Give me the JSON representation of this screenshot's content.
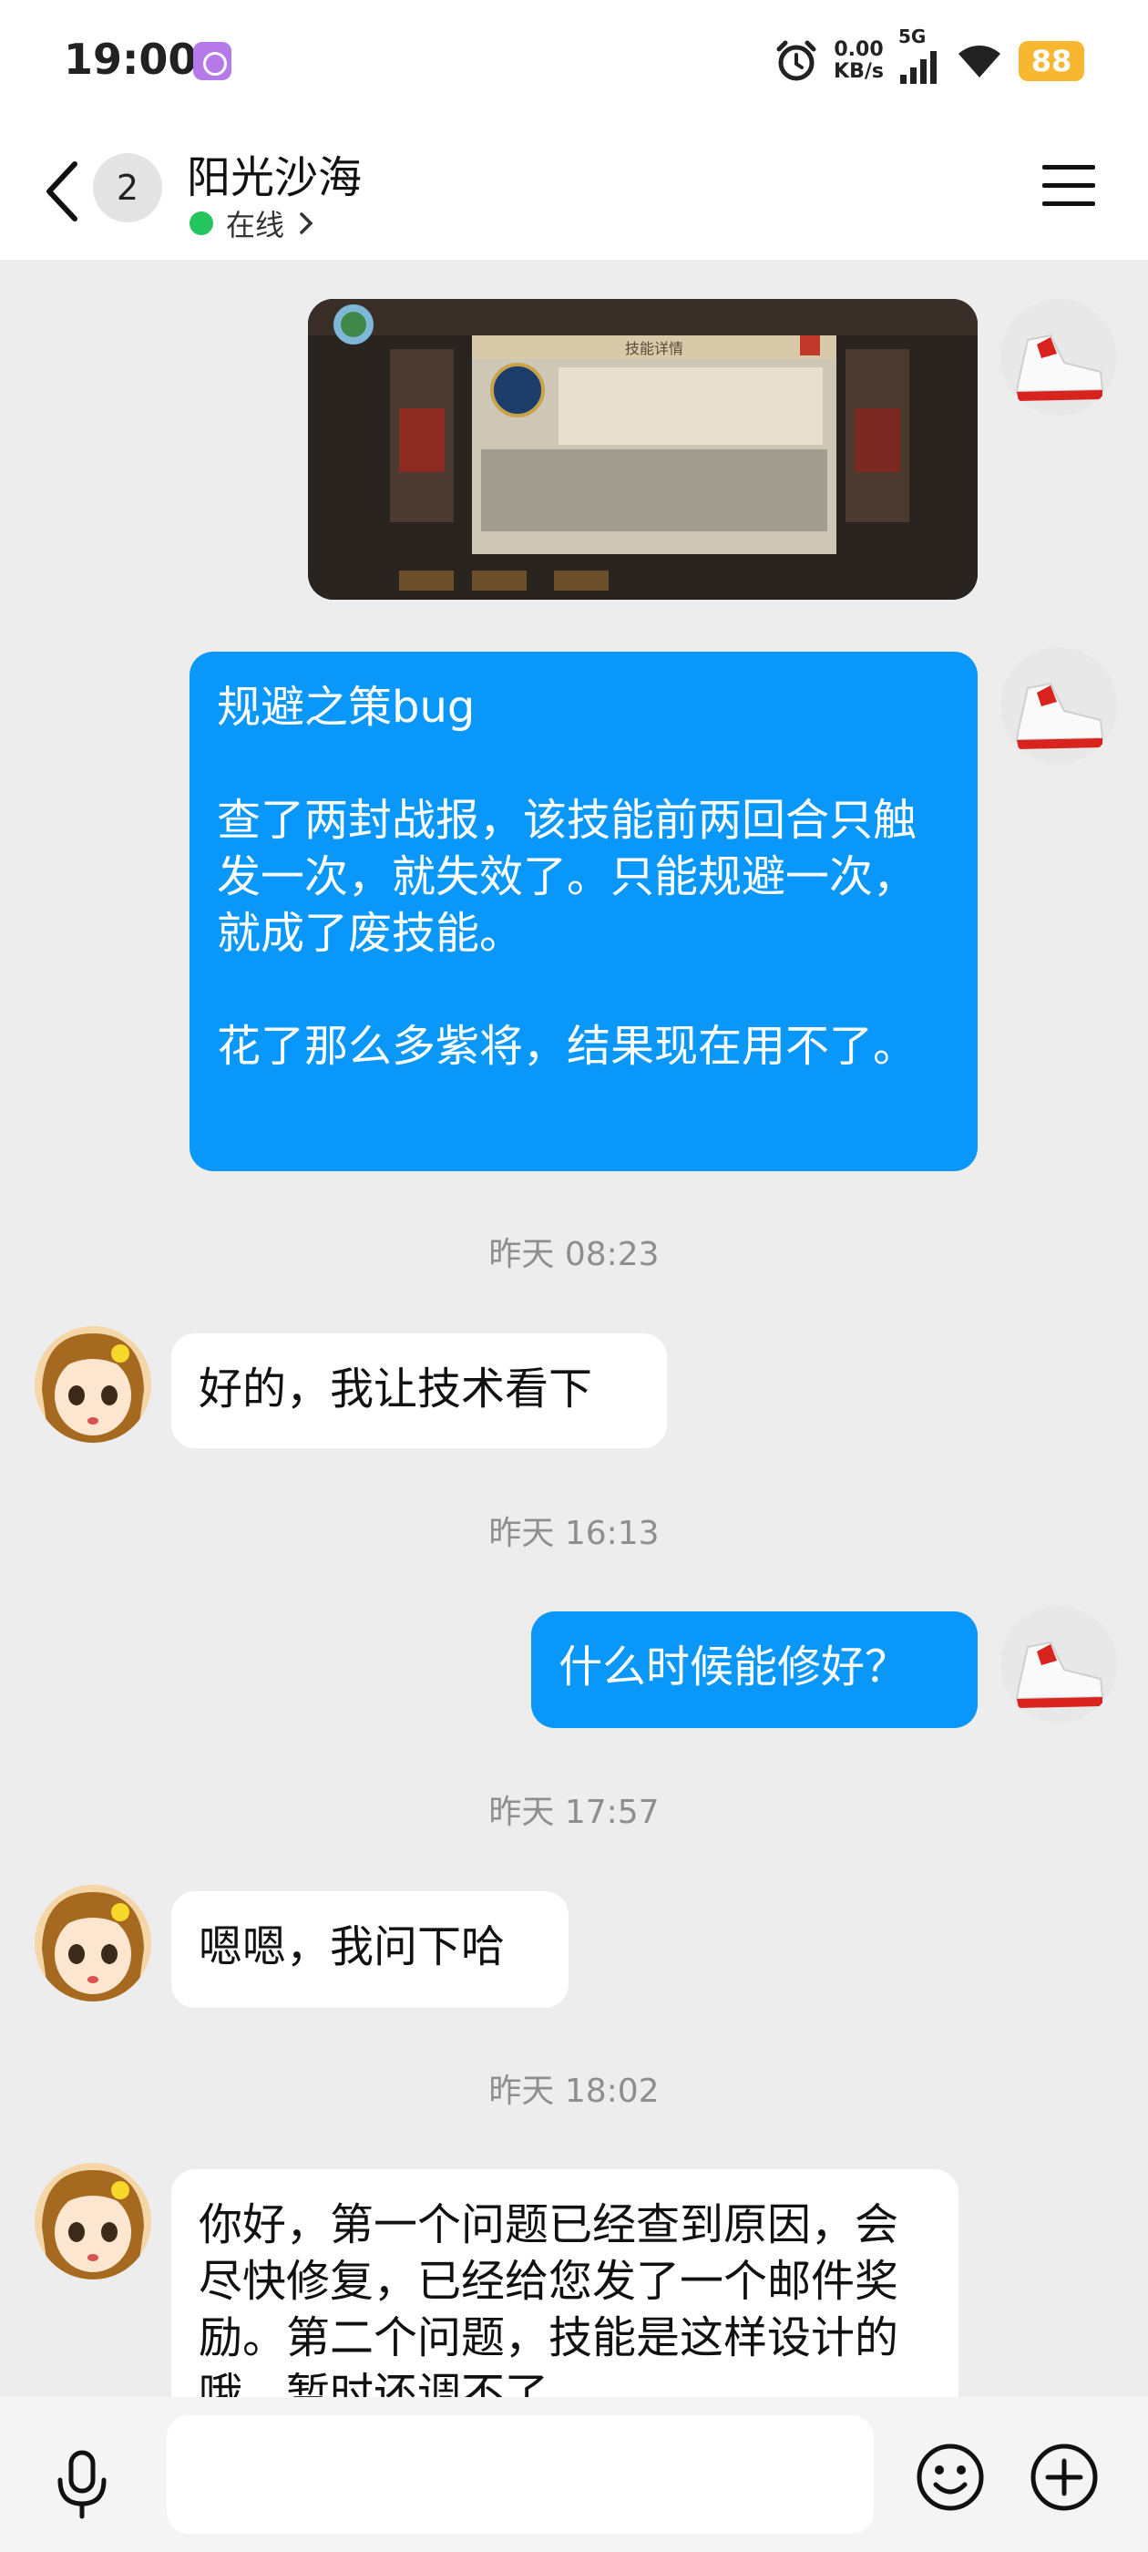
{
  "status_bar": {
    "time": "19:00",
    "net_speed_value": "0.00",
    "net_speed_unit": "KB/s",
    "network_type": "5G",
    "battery": "88"
  },
  "header": {
    "unread_count": "2",
    "title": "阳光沙海",
    "status": "在线"
  },
  "messages": {
    "m1_text": "规避之策bug\n\n查了两封战报，该技能前两回合只触发一次，就失效了。只能规避一次，就成了废技能。\n\n花了那么多紫将，结果现在用不了。",
    "ts1": "昨天 08:23",
    "m2_text": "好的，我让技术看下",
    "ts2": "昨天 16:13",
    "m3_text": "什么时候能修好？",
    "ts3": "昨天 17:57",
    "m4_text": "嗯嗯，我问下哈",
    "ts4": "昨天 18:02",
    "m5_text": "你好，第一个问题已经查到原因，会尽快修复，已经给您发了一个邮件奖励。第二个问题，技能是这样设计的哦，暂时还调不了"
  },
  "image_message": {
    "panel_title": "技能详情"
  },
  "input": {
    "placeholder": ""
  },
  "colors": {
    "outgoing_bubble": "#0a97fa",
    "incoming_bubble": "#ffffff",
    "online": "#22c55e",
    "battery": "#f7b731"
  }
}
